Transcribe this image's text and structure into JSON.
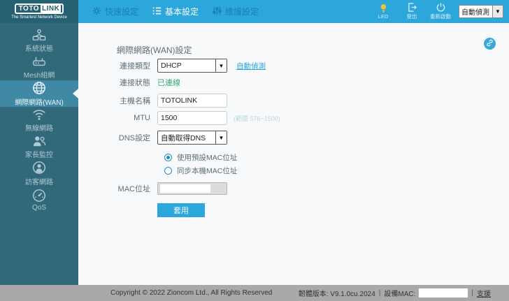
{
  "brand": {
    "name_left": "TOTO",
    "name_right": "LINK",
    "tagline": "The Smartest Network Device"
  },
  "header": {
    "nav": [
      {
        "label": "快速設定",
        "icon": "gear-icon",
        "active": false
      },
      {
        "label": "基本設定",
        "icon": "list-icon",
        "active": true
      },
      {
        "label": "維護設定",
        "icon": "sliders-icon",
        "active": false
      }
    ],
    "actions": [
      {
        "label": "LED",
        "icon": "led-icon"
      },
      {
        "label": "登出",
        "icon": "logout-icon"
      },
      {
        "label": "重新啟動",
        "icon": "restart-icon"
      }
    ],
    "detect_select": {
      "value": "自動偵測"
    }
  },
  "sidebar": {
    "items": [
      {
        "label": "系統狀態",
        "icon": "system-status-icon",
        "active": false
      },
      {
        "label": "Mesh組網",
        "icon": "mesh-router-icon",
        "active": false
      },
      {
        "label": "網際網路(WAN)",
        "icon": "wan-globe-icon",
        "active": true
      },
      {
        "label": "無線網路",
        "icon": "wifi-icon",
        "active": false
      },
      {
        "label": "家長監控",
        "icon": "parental-control-icon",
        "active": false
      },
      {
        "label": "訪客網路",
        "icon": "guest-network-icon",
        "active": false
      },
      {
        "label": "QoS",
        "icon": "qos-gauge-icon",
        "active": false
      }
    ]
  },
  "main": {
    "title": "網際網路(WAN)設定",
    "connection_type": {
      "label": "連接類型",
      "value": "DHCP",
      "detect_link": "自動偵測"
    },
    "connection_status": {
      "label": "連接狀態",
      "value": "已連線"
    },
    "hostname": {
      "label": "主機名稱",
      "value": "TOTOLINK"
    },
    "mtu": {
      "label": "MTU",
      "value": "1500",
      "hint": "(範圍 576~1500)"
    },
    "dns": {
      "label": "DNS設定",
      "value": "自動取得DNS"
    },
    "mac_mode": {
      "options": [
        {
          "label": "使用預設MAC位址",
          "selected": true
        },
        {
          "label": "同步本機MAC位址",
          "selected": false
        }
      ]
    },
    "mac_address": {
      "label": "MAC位址",
      "value": ""
    },
    "apply_label": "套用"
  },
  "footer": {
    "copyright": "Copyright © 2022 Zioncom Ltd., All Rights Reserved",
    "firmware_label": "韌體版本: V9.1.0cu.2024",
    "separator": "|",
    "device_mac_label": "設備MAC:",
    "device_mac_value": "",
    "support_link": "支援"
  },
  "colors": {
    "header_blue": "#2ba7dc",
    "logo_teal": "#256173",
    "sidebar_teal": "#31697b",
    "sidebar_active": "#3f89a5",
    "content_bg": "#f7f9fa",
    "accent_link": "#2ba7dc",
    "status_green": "#3baa77",
    "led_yellow": "#e8c437",
    "footer_gray": "#a9a9a9"
  }
}
